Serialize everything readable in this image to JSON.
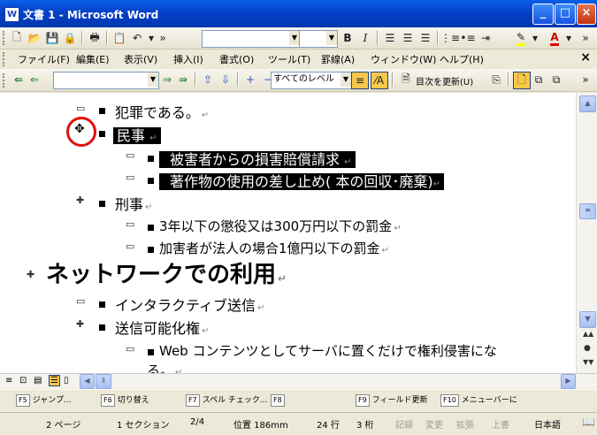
{
  "window": {
    "title": "文書 1 - Microsoft Word",
    "app_icon": "word-doc-icon"
  },
  "toolbar_standard": {
    "style_combo": "",
    "size_combo": "",
    "bold": "B",
    "italic": "I"
  },
  "menu": {
    "items": [
      "ファイル(F)",
      "編集(E)",
      "表示(V)",
      "挿入(I)",
      "書式(O)",
      "ツール(T)",
      "罫線(A)",
      "ウィンドウ(W)",
      "ヘルプ(H)"
    ],
    "close": "×"
  },
  "outline_toolbar": {
    "level_combo": "すべてのレベル",
    "update_toc": "目次を更新(U)"
  },
  "document": {
    "lines": [
      {
        "text": "犯罪である。"
      },
      {
        "text": "民事"
      },
      {
        "text": "被害者からの損害賠償請求"
      },
      {
        "text": "著作物の使用の差し止め( 本の回収･廃棄)"
      },
      {
        "text": "刑事"
      },
      {
        "text": "3年以下の懲役又は300万円以下の罰金"
      },
      {
        "text": "加害者が法人の場合1億円以下の罰金"
      },
      {
        "text": "ネットワークでの利用"
      },
      {
        "text": "インタラクティブ送信"
      },
      {
        "text": "送信可能化権"
      },
      {
        "text": "Web コンテンツとしてサーバに置くだけで権利侵害にな"
      },
      {
        "text": "る。"
      }
    ],
    "para_mark": "↵"
  },
  "function_keys": [
    {
      "key": "F5",
      "label": "ジャンプ..."
    },
    {
      "key": "F6",
      "label": "切り替え"
    },
    {
      "key": "F7",
      "label": "スペル チェック..."
    },
    {
      "key": "F8",
      "label": ""
    },
    {
      "key": "F9",
      "label": "フィールド更新"
    },
    {
      "key": "F10",
      "label": "メニューバーに"
    }
  ],
  "status": {
    "page": "2 ページ",
    "section": "1 セクション",
    "page_of": "2/4",
    "position": "位置 186mm",
    "line": "24 行",
    "column": "3 桁",
    "rec": "記録",
    "trk": "変更",
    "ext": "拡張",
    "ovr": "上書",
    "language": "日本語"
  }
}
